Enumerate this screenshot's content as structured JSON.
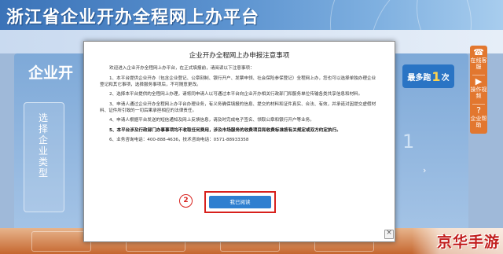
{
  "header": {
    "portal_title": "浙江省企业开办全程网上办平台"
  },
  "background": {
    "left_heading": "企业开",
    "vertical_label": "选择企业类型",
    "logo_text": "最多跑",
    "logo_digit": "1",
    "logo_suffix": "次",
    "big_digit": "1",
    "arrow_text": "›"
  },
  "side_toolbar": {
    "items": [
      {
        "label": "在线客服",
        "icon": "headset-icon",
        "glyph": "☎"
      },
      {
        "label": "操作视频",
        "icon": "play-icon",
        "glyph": "▶"
      },
      {
        "label": "企业帮助",
        "icon": "help-icon",
        "glyph": "?"
      }
    ]
  },
  "modal": {
    "title": "企业开办全程网上办申报注意事项",
    "intro": "欢迎进入企业开办全程网上办平台，在正式填报前，请阅读以下注意事项：",
    "item1": "1、本平台提供企业开办（包含企业登记、公章刻制、银行开户、发票申领、社会保险参保登记）全程网上办，您也可以选择单独办理企业登记和其它事项，选择服务事项后，不可随意更改。",
    "item2": "2、选择本平台提供的全程网上办理，请将同申请人以可通过本平台向企业开办相关行政部门和服务单位传输各类共享信息和材料。",
    "item3": "3、申请人通过企业开办全程网上办平台办理业务，有义务确保填报的信息、提交的材料和证件真实、合法、有效，并承诺对因提交虚假材料、证件所引致的一切后果承担相应的法律责任。",
    "item4": "4、申请人根据平台发送的短信通知及网上反馈信息，请及时完成电子签名、领取公章和银行开户等业务。",
    "item5": "5、本平台涉及行政部门办事事项均不收取任何费用，涉及市场服务的收费项目和收费标准按有关规定或双方约定执行。",
    "item6": "6、业务咨询电话：400-888-4636，技术咨询电话：0571-88933358",
    "confirm_label": "我已阅读",
    "step_number": "2",
    "close_glyph": "×"
  },
  "watermark": "京华手游",
  "colors": {
    "accent_blue": "#2f7fd0",
    "highlight_red": "#d8201c",
    "toolbar_orange": "#e2772f"
  }
}
